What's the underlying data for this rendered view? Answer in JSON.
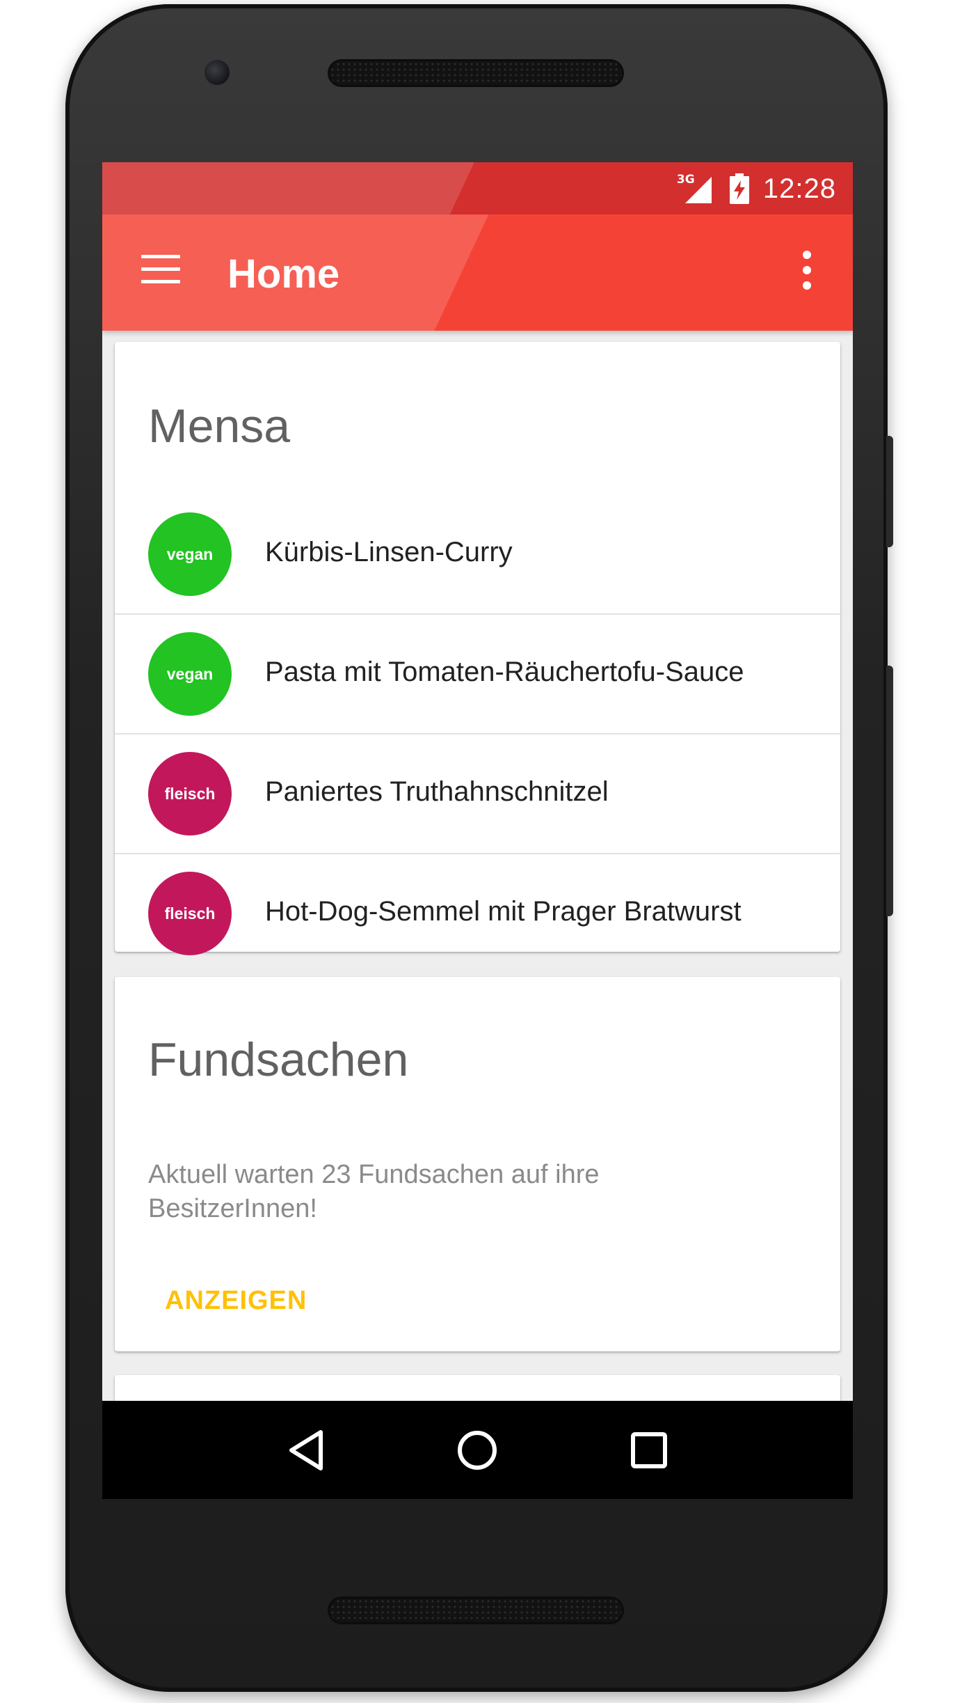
{
  "status_bar": {
    "network": "3G",
    "time": "12:28"
  },
  "app_bar": {
    "title": "Home",
    "menu_icon": "hamburger-menu-icon",
    "overflow_icon": "more-vert-icon"
  },
  "colors": {
    "primary": "#f44336",
    "primary_dark": "#d32f2f",
    "vegan": "#22c322",
    "fleisch": "#c2185b",
    "accent": "#ffc107"
  },
  "mensa": {
    "title": "Mensa",
    "meals": [
      {
        "badge": "vegan",
        "name": "Kürbis-Linsen-Curry"
      },
      {
        "badge": "vegan",
        "name": "Pasta mit Tomaten-Räuchertofu-Sauce"
      },
      {
        "badge": "fleisch",
        "name": "Paniertes Truthahnschnitzel"
      },
      {
        "badge": "fleisch",
        "name": "Hot-Dog-Semmel mit Prager Bratwurst"
      }
    ]
  },
  "fundsachen": {
    "title": "Fundsachen",
    "text": "Aktuell warten 23 Fundsachen auf ihre BesitzerInnen!",
    "action": "ANZEIGEN"
  },
  "nav_bar": {
    "back_icon": "back-triangle-icon",
    "home_icon": "home-circle-icon",
    "recents_icon": "recents-square-icon"
  }
}
